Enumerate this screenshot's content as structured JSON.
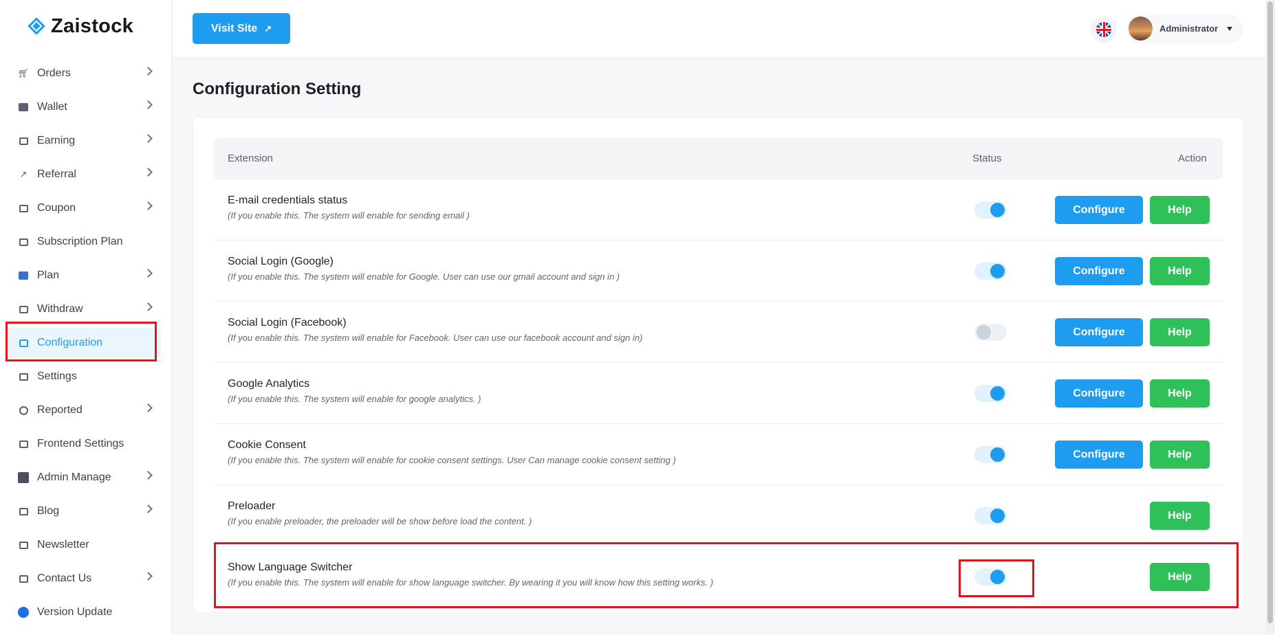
{
  "brand": {
    "name": "Zaistock"
  },
  "sidebar": {
    "items": [
      {
        "label": "Orders",
        "icon": "cart-icon",
        "has_chevron": true
      },
      {
        "label": "Wallet",
        "icon": "wallet-icon",
        "has_chevron": true
      },
      {
        "label": "Earning",
        "icon": "cash-icon",
        "has_chevron": true
      },
      {
        "label": "Referral",
        "icon": "share-icon",
        "has_chevron": true
      },
      {
        "label": "Coupon",
        "icon": "coupon-icon",
        "has_chevron": true
      },
      {
        "label": "Subscription Plan",
        "icon": "subscription-icon",
        "has_chevron": false
      },
      {
        "label": "Plan",
        "icon": "plan-icon",
        "has_chevron": true
      },
      {
        "label": "Withdraw",
        "icon": "withdraw-icon",
        "has_chevron": true
      },
      {
        "label": "Configuration",
        "icon": "configuration-icon",
        "has_chevron": false,
        "active": true
      },
      {
        "label": "Settings",
        "icon": "settings-icon",
        "has_chevron": false
      },
      {
        "label": "Reported",
        "icon": "alert-icon",
        "has_chevron": true
      },
      {
        "label": "Frontend Settings",
        "icon": "frontend-icon",
        "has_chevron": false
      },
      {
        "label": "Admin Manage",
        "icon": "admin-icon",
        "has_chevron": true
      },
      {
        "label": "Blog",
        "icon": "blog-icon",
        "has_chevron": true
      },
      {
        "label": "Newsletter",
        "icon": "newsletter-icon",
        "has_chevron": false
      },
      {
        "label": "Contact Us",
        "icon": "contact-icon",
        "has_chevron": true
      },
      {
        "label": "Version Update",
        "icon": "version-icon",
        "has_chevron": false
      }
    ]
  },
  "header": {
    "visit_site_label": "Visit Site",
    "language_icon": "uk-flag-icon",
    "user_name": "Administrator"
  },
  "main": {
    "title": "Configuration Setting",
    "table": {
      "headers": {
        "extension": "Extension",
        "status": "Status",
        "action": "Action"
      },
      "rows": [
        {
          "title": "E-mail credentials status",
          "desc": "(If you enable this. The system will enable for sending email )",
          "enabled": true,
          "configure_label": "Configure",
          "help_label": "Help"
        },
        {
          "title": "Social Login (Google)",
          "desc": "(If you enable this. The system will enable for Google. User can use our gmail account and sign in )",
          "enabled": true,
          "configure_label": "Configure",
          "help_label": "Help"
        },
        {
          "title": "Social Login (Facebook)",
          "desc": "(If you enable this. The system will enable for Facebook. User can use our facebook account and sign in)",
          "enabled": false,
          "configure_label": "Configure",
          "help_label": "Help"
        },
        {
          "title": "Google Analytics",
          "desc": "(If you enable this. The system will enable for google analytics. )",
          "enabled": true,
          "configure_label": "Configure",
          "help_label": "Help"
        },
        {
          "title": "Cookie Consent",
          "desc": "(If you enable this. The system will enable for cookie consent settings. User Can manage cookie consent setting )",
          "enabled": true,
          "configure_label": "Configure",
          "help_label": "Help"
        },
        {
          "title": "Preloader",
          "desc": "(If you enable preloader, the preloader will be show before load the content. )",
          "enabled": true,
          "configure_label": "",
          "help_label": "Help"
        },
        {
          "title": "Show Language Switcher",
          "desc": "(If you enable this. The system will enable for show language switcher. By wearing it you will know how this setting works. )",
          "enabled": true,
          "configure_label": "",
          "help_label": "Help"
        }
      ]
    }
  },
  "colors": {
    "primary": "#1e9cf0",
    "success": "#2fc05a",
    "highlight": "#e0141d"
  }
}
